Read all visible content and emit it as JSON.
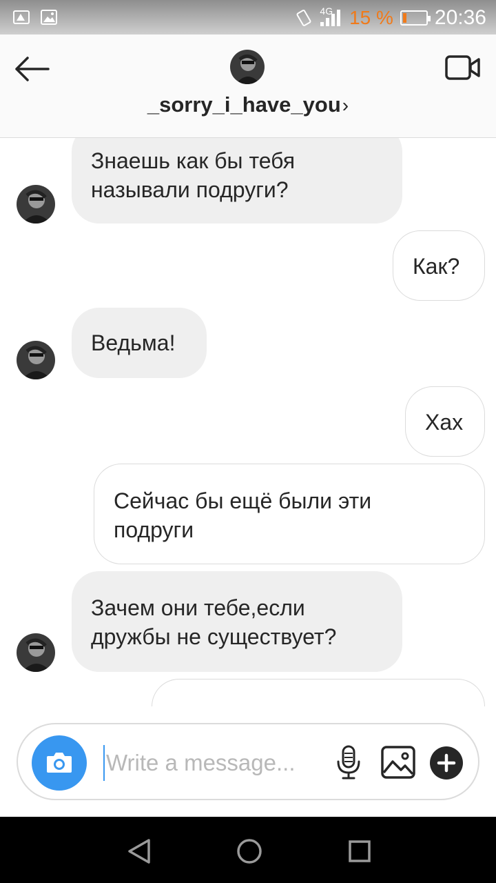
{
  "status_bar": {
    "network": "4G",
    "battery_percent": "15 %",
    "battery_level": 0.15,
    "time": "20:36"
  },
  "header": {
    "username": "_sorry_i_have_you",
    "chevron": "›",
    "icons": [
      "back-arrow-icon",
      "video-call-icon",
      "profile-avatar"
    ]
  },
  "messages": [
    {
      "direction": "incoming",
      "lines": [
        "Знаешь как бы тебя",
        "называли подруги?"
      ]
    },
    {
      "direction": "outgoing",
      "lines": [
        "Как?"
      ]
    },
    {
      "direction": "incoming",
      "lines": [
        "Ведьма!"
      ]
    },
    {
      "direction": "outgoing",
      "lines": [
        "Хах"
      ]
    },
    {
      "direction": "outgoing",
      "lines": [
        "Сейчас бы ещё были эти",
        "подруги"
      ]
    },
    {
      "direction": "incoming",
      "lines": [
        "Зачем они тебе,если",
        "дружбы не существует?"
      ]
    }
  ],
  "composer": {
    "placeholder": "Write a message...",
    "icons": [
      "camera-icon",
      "microphone-icon",
      "gallery-icon",
      "plus-icon"
    ]
  },
  "colors": {
    "accent": "#3897f0",
    "battery_low": "#f07a1a",
    "incoming_bubble": "#efefef",
    "outgoing_border": "#dbdbdb"
  }
}
